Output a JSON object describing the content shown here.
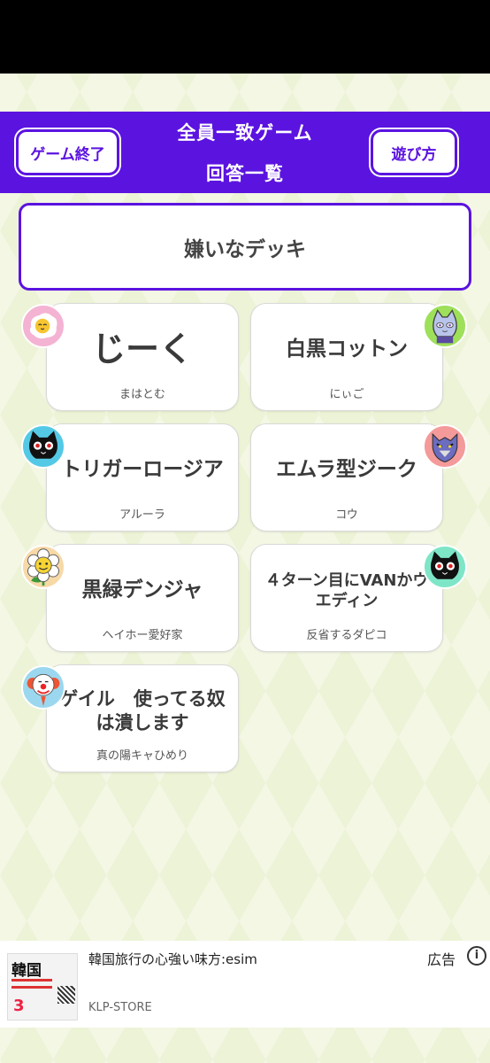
{
  "header": {
    "end_button": "ゲーム終了",
    "help_button": "遊び方",
    "title_line1": "全員一致ゲーム",
    "title_line2": "回答一覧"
  },
  "theme": "嫌いなデッキ",
  "answers": [
    {
      "answer": "じーく",
      "name": "まはとむ",
      "avatar_icon": "fried-egg-icon",
      "avatar_color": "#f4b3d3"
    },
    {
      "answer": "白黒コットン",
      "name": "にぃご",
      "avatar_icon": "blue-cat-icon",
      "avatar_color": "#9ee05a"
    },
    {
      "answer": "トリガーロージア",
      "name": "アルーラ",
      "avatar_icon": "black-cat-icon",
      "avatar_color": "#54c9e6"
    },
    {
      "answer": "エムラ型ジーク",
      "name": "コウ",
      "avatar_icon": "wolf-icon",
      "avatar_color": "#f49a9a"
    },
    {
      "answer": "黒緑デンジャ",
      "name": "ヘイホー愛好家",
      "avatar_icon": "flower-icon",
      "avatar_color": "#f7d9a8"
    },
    {
      "answer": "４ターン目にVANかウエディン",
      "name": "反省するダピコ",
      "avatar_icon": "black-cat-icon",
      "avatar_color": "#7fe5c7"
    },
    {
      "answer": "ゲイル　使ってる奴は潰します",
      "name": "真の陽キャひめり",
      "avatar_icon": "clown-icon",
      "avatar_color": "#9bd8ef"
    }
  ],
  "ad": {
    "title": "韓国旅行の心強い味方:esim",
    "advertiser": "KLP-STORE",
    "label": "広告",
    "info_icon": "info-icon",
    "thumb_text": "韓国",
    "thumb_number": "3"
  },
  "colors": {
    "accent": "#5b13e0",
    "background": "#ecf3d6"
  }
}
